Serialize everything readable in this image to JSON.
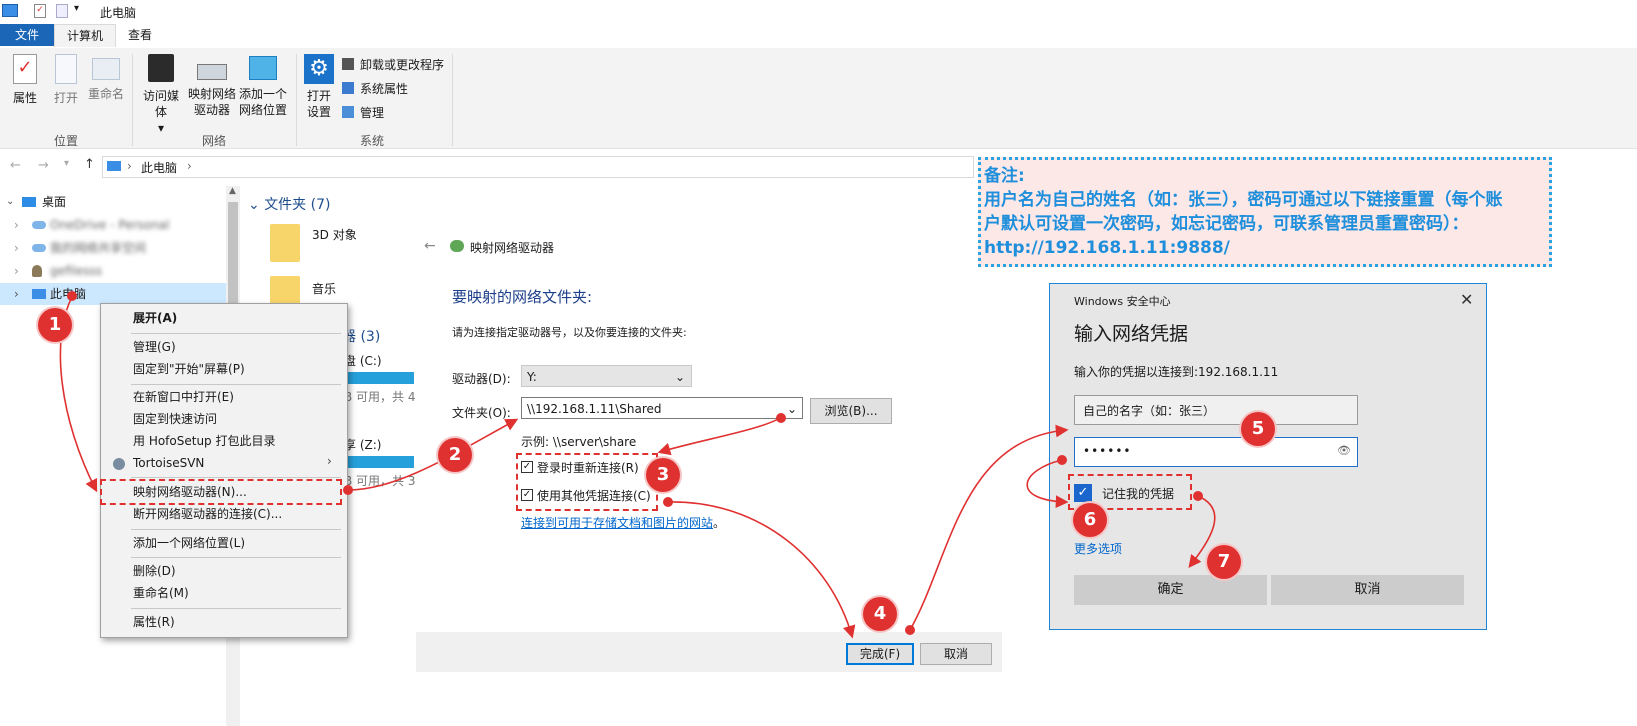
{
  "window": {
    "title": "此电脑"
  },
  "tabs": [
    {
      "label": "文件"
    },
    {
      "label": "计算机"
    },
    {
      "label": "查看"
    }
  ],
  "ribbon": {
    "location": {
      "properties": "属性",
      "open": "打开",
      "rename": "重命名",
      "group": "位置"
    },
    "network": {
      "access_media_1": "访问媒体",
      "map_drive_1": "映射网络",
      "map_drive_2": "驱动器",
      "add_location_1": "添加一个",
      "add_location_2": "网络位置",
      "group": "网络"
    },
    "system": {
      "open_settings_1": "打开",
      "open_settings_2": "设置",
      "uninstall": "卸载或更改程序",
      "sys_props": "系统属性",
      "manage": "管理",
      "group": "系统"
    }
  },
  "address": {
    "path": "此电脑"
  },
  "nav_tree": {
    "desktop": "桌面",
    "onedrive": "OneDrive - Personal",
    "network_item": "我的网络共享空间",
    "user": "gefilesss",
    "this_pc": "此电脑"
  },
  "folders": {
    "header": "文件夹 (7)",
    "item_3d": "3D 对象",
    "item_music": "音乐",
    "devices_header_tail": "器 (3)",
    "drive_c": "盘 (C:)",
    "drive_c_free": "B 可用，共 4",
    "drive_z": "享 (Z:)",
    "drive_z_free": "B 可用，共 3"
  },
  "context_menu": {
    "expand": "展开(A)",
    "manage": "管理(G)",
    "pin_start": "固定到\"开始\"屏幕(P)",
    "open_new_window": "在新窗口中打开(E)",
    "pin_quick": "固定到快速访问",
    "hofosetup": "用 HofoSetup 打包此目录",
    "tortoise": "TortoiseSVN",
    "map_drive": "映射网络驱动器(N)...",
    "disconnect": "断开网络驱动器的连接(C)...",
    "add_location": "添加一个网络位置(L)",
    "delete": "删除(D)",
    "rename": "重命名(M)",
    "properties": "属性(R)"
  },
  "map_dialog": {
    "title": "映射网络驱动器",
    "heading": "要映射的网络文件夹:",
    "instruction": "请为连接指定驱动器号，以及你要连接的文件夹:",
    "drive_label": "驱动器(D):",
    "drive_value": "Y:",
    "folder_label": "文件夹(O):",
    "folder_value": "\\\\192.168.1.11\\Shared",
    "browse": "浏览(B)...",
    "example": "示例: \\\\server\\share",
    "reconnect": "登录时重新连接(R)",
    "other_creds": "使用其他凭据连接(C)",
    "link": "连接到可用于存储文档和图片的网站",
    "link_suffix": "。",
    "finish": "完成(F)",
    "cancel": "取消"
  },
  "note": {
    "line1": "备注:",
    "line2": "用户名为自己的姓名（如：张三），密码可通过以下链接重置（每个账",
    "line3": "户默认可设置一次密码，如忘记密码，可联系管理员重置密码）：",
    "line4": "http://192.168.1.11:9888/"
  },
  "cred_dialog": {
    "app": "Windows 安全中心",
    "title": "输入网络凭据",
    "subtitle": "输入你的凭据以连接到:192.168.1.11",
    "username": "自己的名字（如：张三）",
    "password": "••••••",
    "remember": "记住我的凭据",
    "more": "更多选项",
    "ok": "确定",
    "cancel": "取消"
  },
  "steps": [
    "1",
    "2",
    "3",
    "4",
    "5",
    "6",
    "7"
  ],
  "colors": {
    "accent": "#1c66b8",
    "marker": "#e03131",
    "note_text": "#1f8fdb",
    "note_bg": "#fde8e8"
  }
}
